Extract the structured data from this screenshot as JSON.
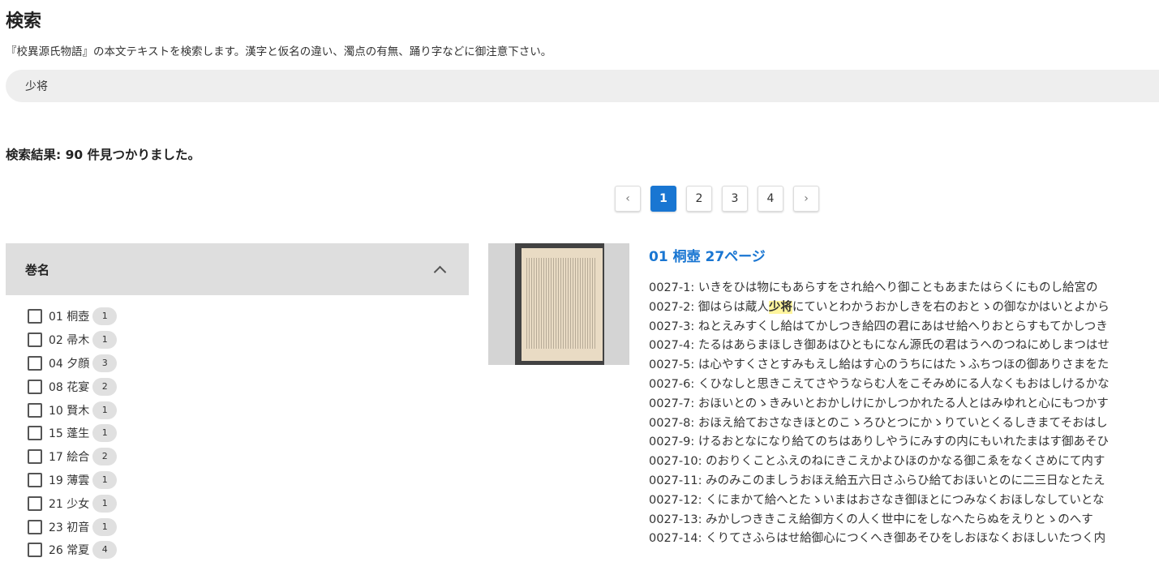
{
  "page": {
    "title": "検索",
    "description": "『校異源氏物語』の本文テキストを検索します。漢字と仮名の違い、濁点の有無、踊り字などに御注意下さい。"
  },
  "search": {
    "value": "少将"
  },
  "results": {
    "count_text": "検索結果: 90 件見つかりました。"
  },
  "pagination": {
    "prev_icon": "chevron-left-icon",
    "next_icon": "chevron-right-icon",
    "pages": [
      "1",
      "2",
      "3",
      "4"
    ],
    "current": "1"
  },
  "facet": {
    "title": "巻名",
    "toggle_icon": "chevron-up-icon",
    "items": [
      {
        "label": "01 桐壺",
        "count": "1"
      },
      {
        "label": "02 帚木",
        "count": "1"
      },
      {
        "label": "04 夕顔",
        "count": "3"
      },
      {
        "label": "08 花宴",
        "count": "2"
      },
      {
        "label": "10 賢木",
        "count": "1"
      },
      {
        "label": "15 蓬生",
        "count": "1"
      },
      {
        "label": "17 絵合",
        "count": "2"
      },
      {
        "label": "19 薄雲",
        "count": "1"
      },
      {
        "label": "21 少女",
        "count": "1"
      },
      {
        "label": "23 初音",
        "count": "1"
      },
      {
        "label": "26 常夏",
        "count": "4"
      }
    ]
  },
  "result_item": {
    "title": "01 桐壺 27ページ",
    "lines": [
      {
        "pre": "0027-1: いきをひは物にもあらすをされ給へり御こともあまたはらくにものし給宮の",
        "hl": "",
        "post": ""
      },
      {
        "pre": "0027-2: 御はらは蔵人",
        "hl": "少将",
        "post": "にていとわかうおかしきを右のおとゝの御なかはいとよから"
      },
      {
        "pre": "0027-3: ねとえみすくし給はてかしつき給四の君にあはせ給へりおとらすもてかしつき",
        "hl": "",
        "post": ""
      },
      {
        "pre": "0027-4: たるはあらまほしき御あはひともになん源氏の君はうへのつねにめしまつはせ",
        "hl": "",
        "post": ""
      },
      {
        "pre": "0027-5: は心やすくさとすみもえし給はす心のうちにはたゝふちつほの御ありさまをた",
        "hl": "",
        "post": ""
      },
      {
        "pre": "0027-6: くひなしと思きこえてさやうならむ人をこそみめにる人なくもおはしけるかな",
        "hl": "",
        "post": ""
      },
      {
        "pre": "0027-7: おほいとのゝきみいとおかしけにかしつかれたる人とはみゆれと心にもつかす",
        "hl": "",
        "post": ""
      },
      {
        "pre": "0027-8: おほえ給ておさなきほとのこゝろひとつにかゝりていとくるしきまてそおはし",
        "hl": "",
        "post": ""
      },
      {
        "pre": "0027-9: けるおとなになり給てのちはありしやうにみすの内にもいれたまはす御あそひ",
        "hl": "",
        "post": ""
      },
      {
        "pre": "0027-10: のおりくことふえのねにきこえかよひほのかなる御こゑをなくさめにて内す",
        "hl": "",
        "post": ""
      },
      {
        "pre": "0027-11: みのみこのましうおほえ給五六日さふらひ給ておほいとのに二三日なとたえ",
        "hl": "",
        "post": ""
      },
      {
        "pre": "0027-12: くにまかて給へとたゝいまはおさなき御ほとにつみなくおほしなしていとな",
        "hl": "",
        "post": ""
      },
      {
        "pre": "0027-13: みかしつききこえ給御方くの人く世中にをしなへたらぬをえりとゝのへす",
        "hl": "",
        "post": ""
      },
      {
        "pre": "0027-14: くりてさふらはせ給御心につくへき御あそひをしおほなくおほしいたつく内",
        "hl": "",
        "post": ""
      }
    ]
  }
}
